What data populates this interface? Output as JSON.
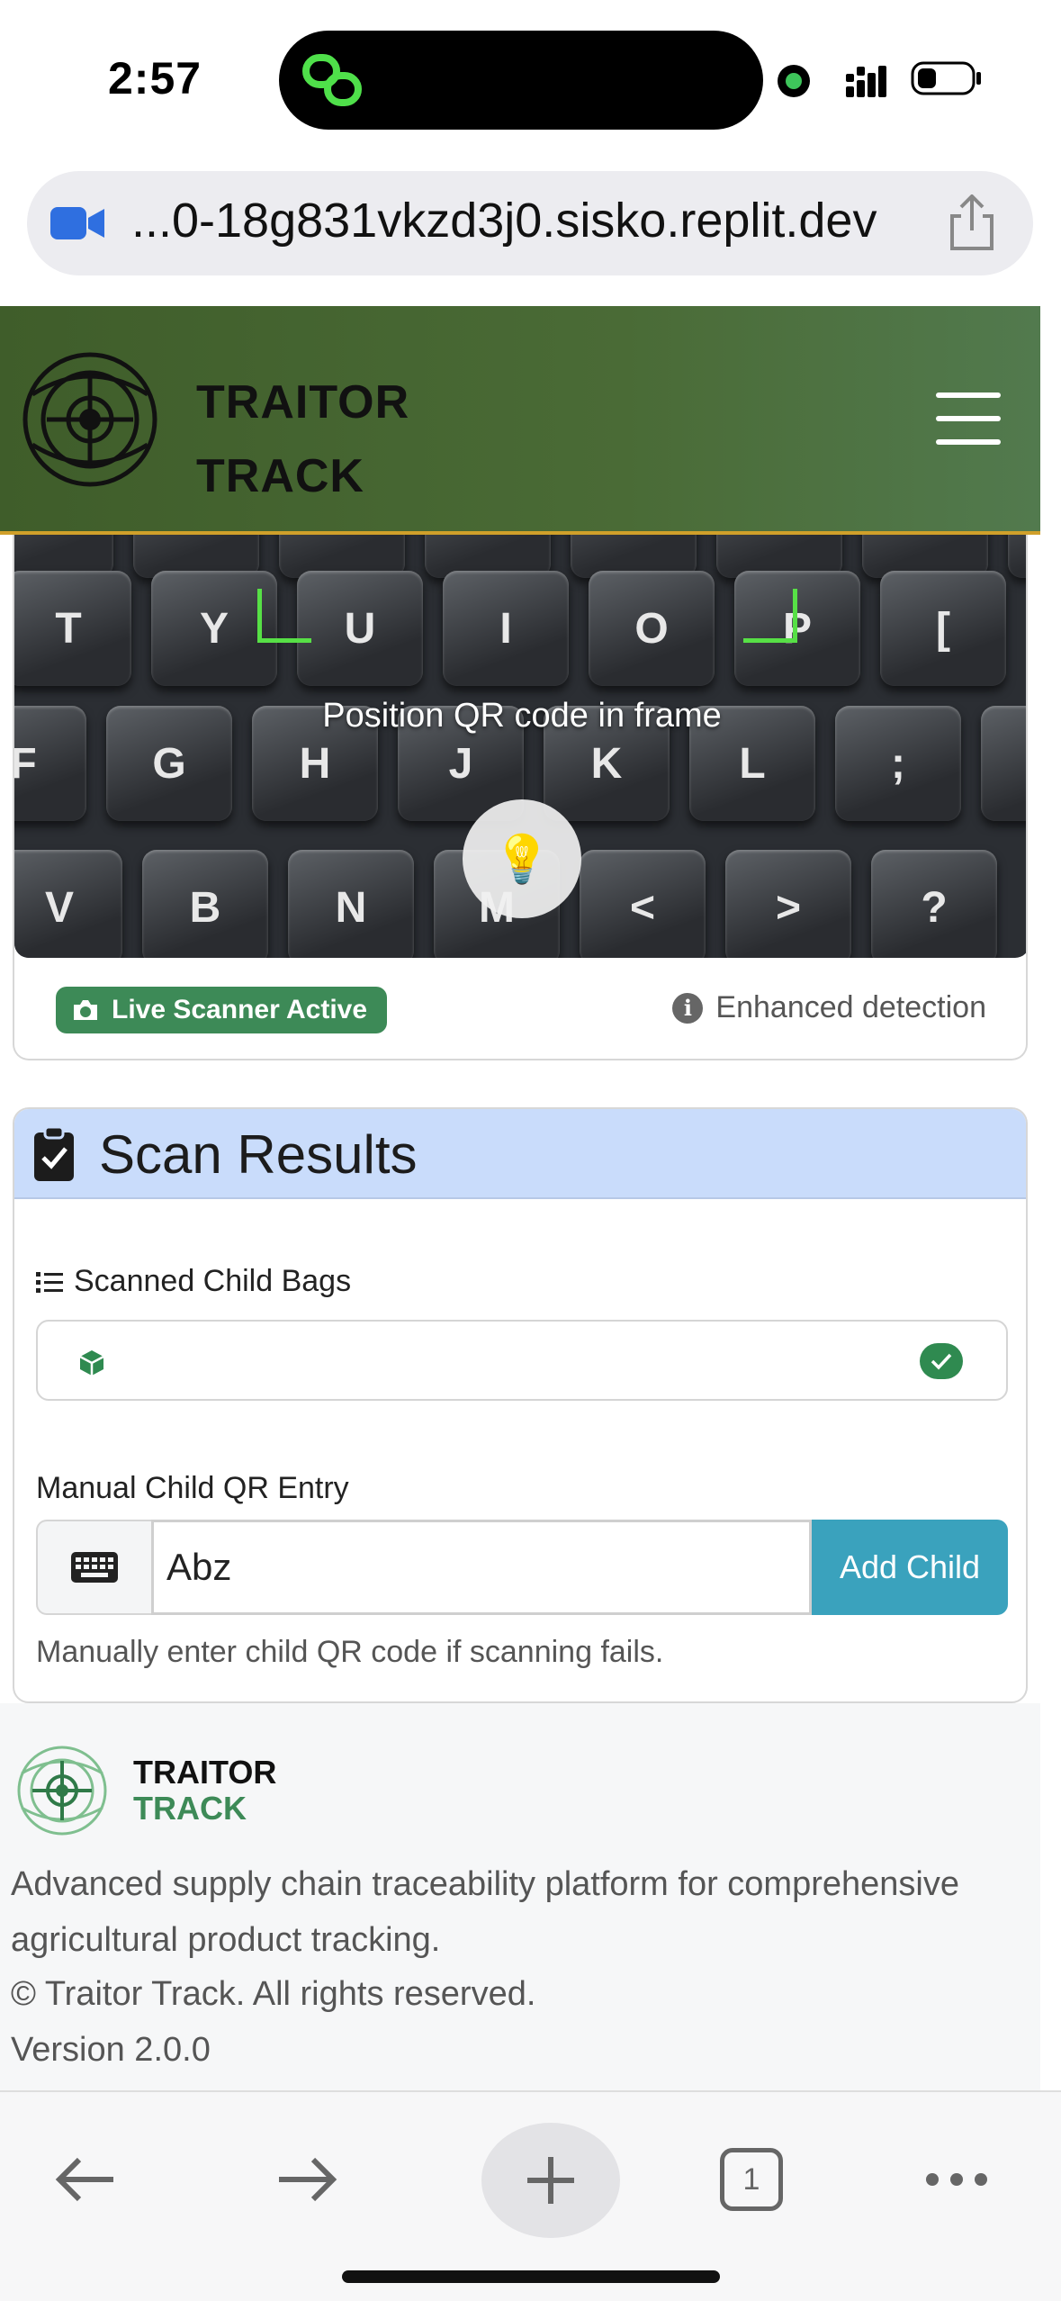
{
  "status_bar": {
    "time": "2:57"
  },
  "browser": {
    "url": "...0-18g831vkzd3j0.sisko.replit.dev"
  },
  "header": {
    "brand_line1": "TRAITOR",
    "brand_line2": "TRACK"
  },
  "scanner": {
    "keys_row1": [
      "T",
      "Y",
      "U",
      "I",
      "O",
      "P",
      "["
    ],
    "keys_row2": [
      "F",
      "G",
      "H",
      "J",
      "K",
      "L",
      ";",
      "'"
    ],
    "keys_row3": [
      "V",
      "B",
      "N",
      "M",
      "<",
      ">",
      "?"
    ],
    "prompt": "Position QR code in frame",
    "torch_glyph": "💡",
    "live_badge": "Live Scanner Active",
    "detection_label": "Enhanced detection",
    "accent_green": "#57e046"
  },
  "results": {
    "title": "Scan Results",
    "child_bags_label": "Scanned Child Bags",
    "manual_label": "Manual Child QR Entry",
    "input_value": "Abz",
    "add_button": "Add Child",
    "help_text": "Manually enter child QR code if scanning fails.",
    "header_color": "#c9dcfb",
    "button_color": "#3aa2bd"
  },
  "footer": {
    "brand_line1": "TRAITOR",
    "brand_line2": "TRACK",
    "description": "Advanced supply chain traceability platform for comprehensive agricultural product tracking.",
    "copyright": "© Traitor Track. All rights reserved.",
    "version": "Version 2.0.0"
  },
  "toolbar": {
    "tab_count": "1"
  }
}
